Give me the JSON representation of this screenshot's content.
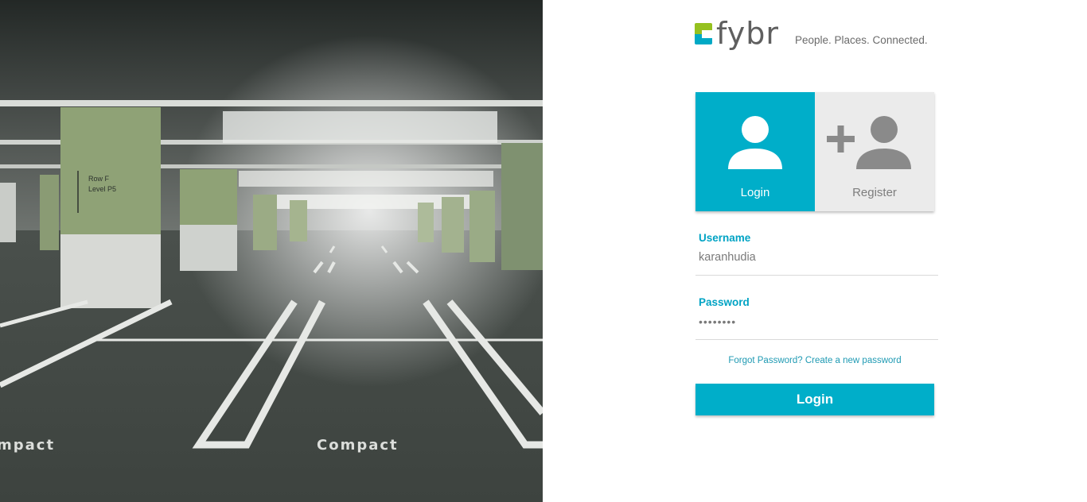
{
  "brand": {
    "logo_text": "fybr",
    "tagline": "People. Places. Connected.",
    "primary_color": "#00aec9",
    "accent_color": "#95c11f"
  },
  "hero": {
    "image": "parking-garage-photo",
    "signage_row": "Row F",
    "signage_level": "Level P5",
    "floor_text_left": "mpact",
    "floor_text_right": "Compact"
  },
  "tabs": [
    {
      "label": "Login",
      "icon": "user-icon",
      "active": true
    },
    {
      "label": "Register",
      "icon": "add-user-icon",
      "active": false
    }
  ],
  "form": {
    "username_label": "Username",
    "username_value": "karanhudia",
    "password_label": "Password",
    "password_value": "••••••••",
    "forgot_text": "Forgot Password? Create a new password",
    "submit_label": "Login"
  }
}
